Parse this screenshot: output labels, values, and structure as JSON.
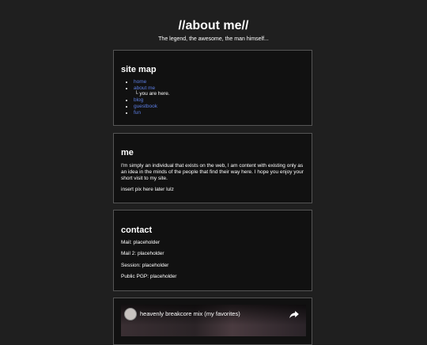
{
  "header": {
    "title": "//about me//",
    "tagline": "The legend, the awesome, the man himself..."
  },
  "sitemap": {
    "heading": "site map",
    "links": [
      "home",
      "about me",
      "blog",
      "guestbook",
      "fun"
    ],
    "here_marker": "└ you are here."
  },
  "me": {
    "heading": "me",
    "paragraph": "I'm simply an individual that exists on the web, I am content with existing only as an idea in the minds of the people that find their way here. I hope you enjoy your short visit to my site.",
    "note": "insert pix here later lulz"
  },
  "contact": {
    "heading": "contact",
    "lines": [
      "Mail: placeholder",
      "Mail 2: placeholder",
      "Session: placeholder",
      "Public PGP: placeholder"
    ]
  },
  "video": {
    "title": "heavenly breakcore mix (my favorites)",
    "icons": [
      "channel-avatar-icon",
      "share-icon"
    ]
  },
  "colors": {
    "background": "#1f1f1f",
    "box": "#111111",
    "border": "#555555",
    "link": "#5b7de3"
  }
}
